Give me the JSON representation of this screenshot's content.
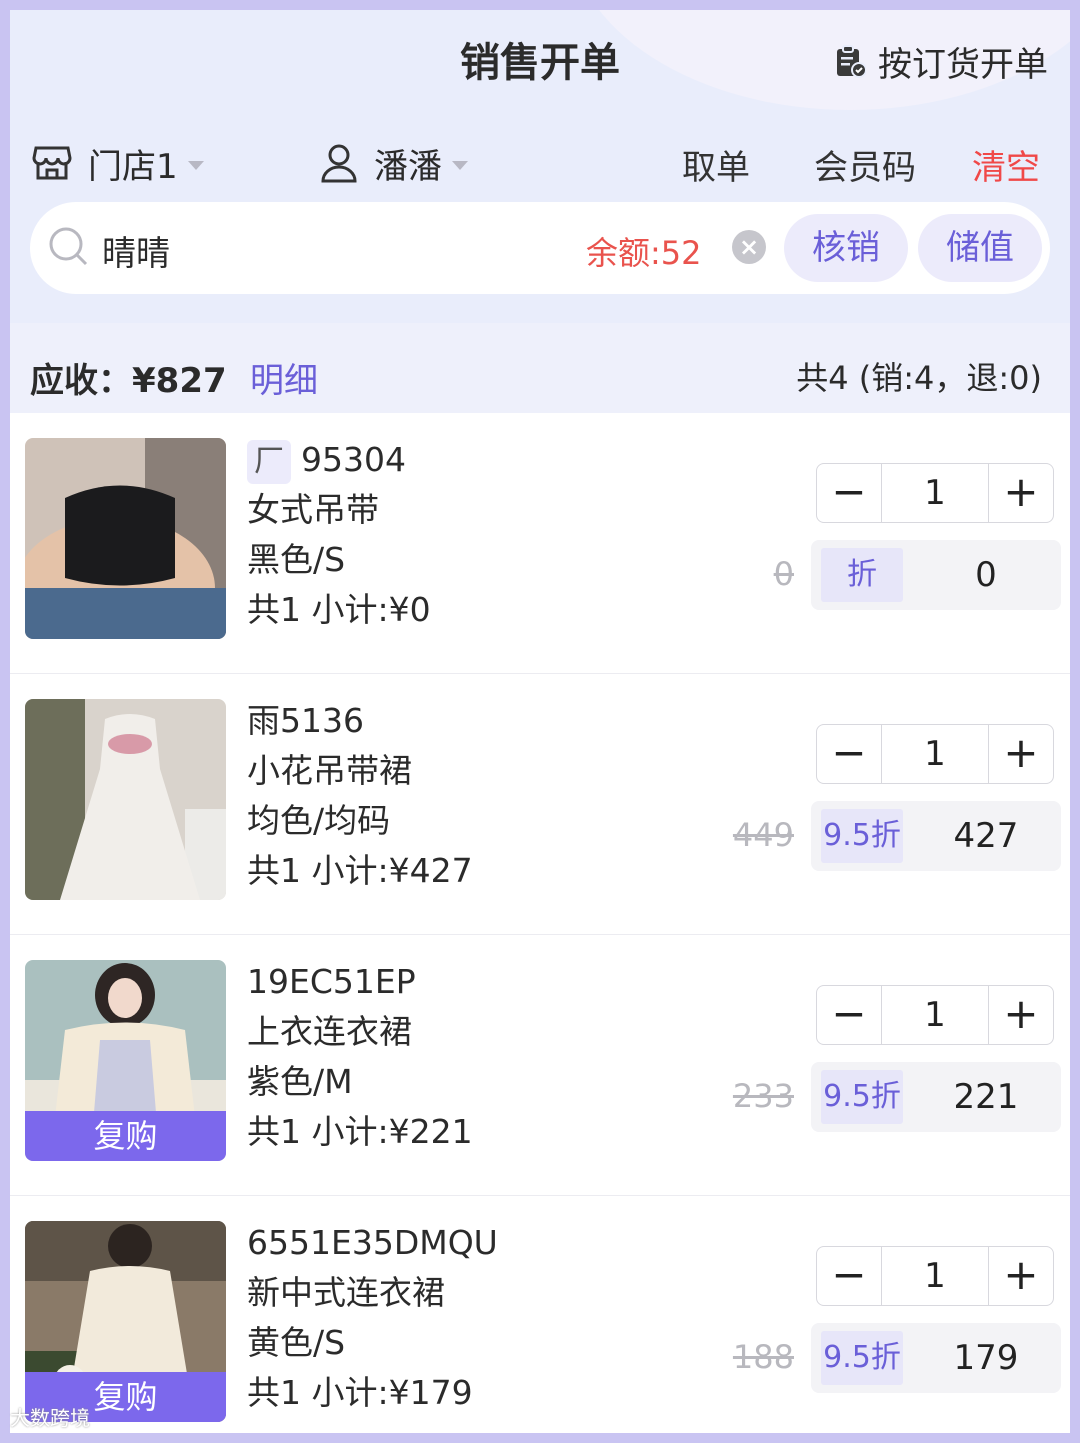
{
  "header": {
    "title": "销售开单",
    "order_link_label": "按订货开单"
  },
  "selectors": {
    "store": "门店1",
    "staff": "潘潘"
  },
  "actions": {
    "take_order": "取单",
    "member_code": "会员码",
    "clear": "清空"
  },
  "search": {
    "value": "晴晴",
    "balance": "余额:52",
    "redeem": "核销",
    "topup": "储值"
  },
  "summary": {
    "receivable": "应收：¥827",
    "detail": "明细",
    "count": "共4 (销:4，退:0)"
  },
  "items": [
    {
      "tag": "厂",
      "code": "95304",
      "name": "女式吊带",
      "spec": "黑色/S",
      "subtotal": "共1 小计:¥0",
      "qty": "1",
      "original": "0",
      "discount": "折",
      "final": "0",
      "rebuy": ""
    },
    {
      "tag": "",
      "code": "雨5136",
      "name": "小花吊带裙",
      "spec": "均色/均码",
      "subtotal": "共1 小计:¥427",
      "qty": "1",
      "original": "449",
      "discount": "9.5折",
      "final": "427",
      "rebuy": ""
    },
    {
      "tag": "",
      "code": "19EC51EP",
      "name": "上衣连衣裙",
      "spec": "紫色/M",
      "subtotal": "共1 小计:¥221",
      "qty": "1",
      "original": "233",
      "discount": "9.5折",
      "final": "221",
      "rebuy": "复购"
    },
    {
      "tag": "",
      "code": "6551E35DMQU",
      "name": "新中式连衣裙",
      "spec": "黄色/S",
      "subtotal": "共1 小计:¥179",
      "qty": "1",
      "original": "188",
      "discount": "9.5折",
      "final": "179",
      "rebuy": "复购"
    }
  ],
  "stepper": {
    "minus": "−",
    "plus": "+"
  },
  "watermark": "大数跨境",
  "colors": {
    "accent": "#6a5fd8",
    "danger": "#f04848",
    "frame": "#c9c4f2"
  }
}
